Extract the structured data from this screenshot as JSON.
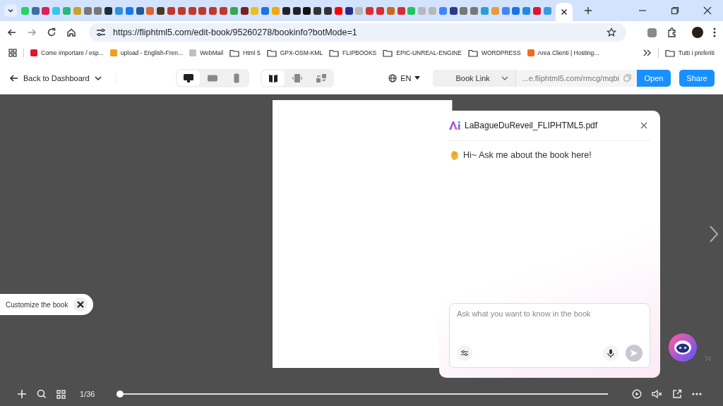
{
  "browser": {
    "tabs": [
      {
        "selected": false,
        "color": "#25d366"
      },
      {
        "selected": false,
        "color": "#3a6ea5"
      },
      {
        "selected": false,
        "color": "#e01e5a"
      },
      {
        "selected": false,
        "color": "#36c5f0"
      },
      {
        "selected": false,
        "color": "#2eb67d"
      },
      {
        "selected": false,
        "color": "#c9a227"
      },
      {
        "selected": false,
        "color": "#777777"
      },
      {
        "selected": false,
        "color": "#777777"
      },
      {
        "selected": false,
        "color": "#1d2b3a"
      },
      {
        "selected": false,
        "color": "#2f8fe0"
      },
      {
        "selected": false,
        "color": "#1877f2"
      },
      {
        "selected": false,
        "color": "#1f5c99"
      },
      {
        "selected": false,
        "color": "#e2622b"
      },
      {
        "selected": false,
        "color": "#4a3b1f"
      },
      {
        "selected": false,
        "color": "#c0392b"
      },
      {
        "selected": false,
        "color": "#c0392b"
      },
      {
        "selected": false,
        "color": "#c0392b"
      },
      {
        "selected": false,
        "color": "#c0392b"
      },
      {
        "selected": false,
        "color": "#c0392b"
      },
      {
        "selected": false,
        "color": "#c0392b"
      },
      {
        "selected": false,
        "color": "#34a853"
      },
      {
        "selected": false,
        "color": "#7b1f1f"
      },
      {
        "selected": false,
        "color": "#e8c21a"
      },
      {
        "selected": false,
        "color": "#1a73e8"
      },
      {
        "selected": false,
        "color": "#f2a900"
      },
      {
        "selected": false,
        "color": "#222222"
      },
      {
        "selected": false,
        "color": "#222222"
      },
      {
        "selected": false,
        "color": "#111111"
      },
      {
        "selected": false,
        "color": "#333333"
      },
      {
        "selected": false,
        "color": "#333333"
      },
      {
        "selected": false,
        "color": "#ff0000"
      },
      {
        "selected": false,
        "color": "#2b2b8a"
      },
      {
        "selected": false,
        "color": "#b8b8b8"
      },
      {
        "selected": false,
        "color": "#d62f2f"
      },
      {
        "selected": false,
        "color": "#d62f2f"
      },
      {
        "selected": false,
        "color": "#c96a1e"
      },
      {
        "selected": false,
        "color": "#d62f2f"
      },
      {
        "selected": false,
        "color": "#22c55e"
      },
      {
        "selected": false,
        "color": "#b8b8b8"
      },
      {
        "selected": false,
        "color": "#b8b8b8"
      },
      {
        "selected": false,
        "color": "#4285f4"
      },
      {
        "selected": false,
        "color": "#2b3a8a"
      },
      {
        "selected": false,
        "color": "#777777"
      },
      {
        "selected": false,
        "color": "#777777"
      },
      {
        "selected": false,
        "color": "#2a9fd6"
      },
      {
        "selected": false,
        "color": "#e89a3c"
      },
      {
        "selected": false,
        "color": "#4285f4"
      },
      {
        "selected": false,
        "color": "#1a73e8"
      },
      {
        "selected": false,
        "color": "#1e88e5"
      },
      {
        "selected": false,
        "color": "#e0162b"
      },
      {
        "selected": false,
        "color": "#3a9be0"
      },
      {
        "selected": true
      }
    ],
    "url": "https://fliphtml5.com/edit-book/95260278/bookinfo?botMode=1",
    "bookmarks": [
      {
        "kind": "site",
        "label": "Come importare / esp...",
        "color": "#e0162b"
      },
      {
        "kind": "site",
        "label": "upload - English-Fren...",
        "color": "#f29c1f"
      },
      {
        "kind": "site",
        "label": "WebMail",
        "color": "#c0c0c0"
      },
      {
        "kind": "folder",
        "label": "Html 5"
      },
      {
        "kind": "folder",
        "label": "GPX-OSM-KML"
      },
      {
        "kind": "folder",
        "label": "FLIPBOOKS"
      },
      {
        "kind": "folder",
        "label": "EPIC-UNREAL-ENGINE"
      },
      {
        "kind": "folder",
        "label": "WORDPRESS"
      },
      {
        "kind": "site",
        "label": "Area Clienti | Hosting...",
        "color": "#f26b21"
      }
    ],
    "other_bookmarks": "Tutti i preferiti"
  },
  "toolbar": {
    "back": "Back to Dashboard",
    "views": [
      {
        "selected": true
      },
      {
        "selected": false
      },
      {
        "selected": false
      }
    ],
    "modes": [
      {
        "selected": true
      },
      {
        "selected": false
      },
      {
        "selected": false
      }
    ],
    "language": "EN",
    "link_type": "Book Link",
    "link": "...e.fliphtml5.com/rmcg/mqbi",
    "open": "Open",
    "share": "Share"
  },
  "viewer": {
    "customize": "Customize the book",
    "page": "1/36",
    "progress": {
      "level": 0
    }
  },
  "chat": {
    "title": "LaBagueDuReveil_FLIPHTML5.pdf",
    "greeting": "Hi~ Ask me about the book here!",
    "placeholder": "Ask what you want to know in the book"
  }
}
